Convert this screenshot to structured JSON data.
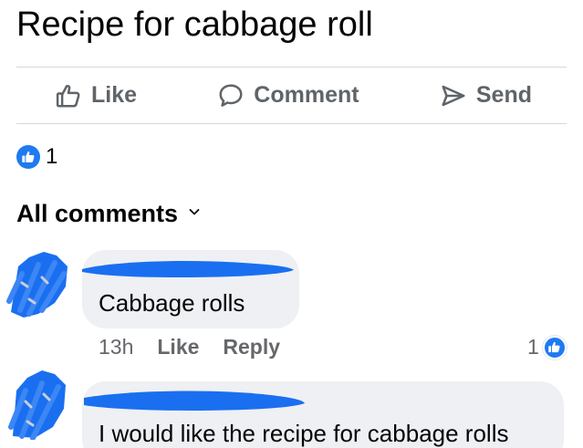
{
  "post": {
    "text": "Recipe for cabbage roll"
  },
  "actions": [
    {
      "label": "Like",
      "icon": "thumbs-up-icon"
    },
    {
      "label": "Comment",
      "icon": "speech-bubble-icon"
    },
    {
      "label": "Send",
      "icon": "paper-plane-icon"
    }
  ],
  "reactions": {
    "count": "1",
    "icon": "like-reaction-icon"
  },
  "comments_filter": {
    "label": "All comments",
    "icon": "chevron-down-icon"
  },
  "comments": [
    {
      "text": "Cabbage rolls",
      "time": "13h",
      "like_label": "Like",
      "reply_label": "Reply",
      "reaction_count": "1"
    },
    {
      "text": "I would like the recipe for cabbage  rolls"
    }
  ],
  "colors": {
    "accent_blue": "#1f7af1",
    "redaction_blue": "#1a6ff0",
    "muted_text": "#65676b",
    "bubble_bg": "#eef0f3"
  }
}
